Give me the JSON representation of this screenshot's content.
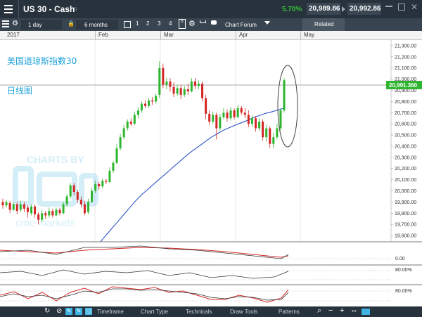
{
  "window": {
    "title": "US 30 - Cash",
    "change_pct": "5.70%",
    "sell_price": "20,989.86",
    "buy_price": "20,992.86"
  },
  "toolbar": {
    "interval": "1 day",
    "range": "6 months",
    "numbers": [
      "1",
      "2",
      "3",
      "4",
      "6"
    ],
    "chart_forum": "Chart Forum",
    "related": "Related"
  },
  "timeline": {
    "year": "2017",
    "months": [
      "Feb",
      "Mar",
      "Apr",
      "May"
    ]
  },
  "annotations": {
    "title_cn": "美国道琼斯指数30",
    "subtitle_cn": "日线图"
  },
  "watermark": {
    "line1": "CHARTS BY",
    "line2": "cmc markets"
  },
  "price_label": "20,991.360",
  "indicator_labels": [
    "0.00",
    "80.00%",
    "80.00%"
  ],
  "bottom_tabs": [
    "Timeframe",
    "Chart Type",
    "Technicals",
    "Draw Tools",
    "Patterns"
  ],
  "colors": {
    "up": "#2fb52f",
    "down": "#d42727",
    "ma": "#2a56c6",
    "panel": "#27323c",
    "accent": "#3fb3e3"
  },
  "chart_data": {
    "type": "candlestick",
    "y_ticks": [
      "21,300.00",
      "21,200.00",
      "21,100.00",
      "21,000.00",
      "20,900.00",
      "20,800.00",
      "20,700.00",
      "20,600.00",
      "20,500.00",
      "20,400.00",
      "20,300.00",
      "20,200.00",
      "20,100.00",
      "20,000.00",
      "19,900.00",
      "19,800.00",
      "19,700.00",
      "19,600.00"
    ],
    "ylim": [
      19550,
      21350
    ],
    "last_price": 20991.36,
    "candles": [
      {
        "o": 19900,
        "c": 19870,
        "h": 19930,
        "l": 19840
      },
      {
        "o": 19870,
        "c": 19900,
        "h": 19920,
        "l": 19850
      },
      {
        "o": 19890,
        "c": 19830,
        "h": 19910,
        "l": 19800
      },
      {
        "o": 19830,
        "c": 19880,
        "h": 19900,
        "l": 19820
      },
      {
        "o": 19880,
        "c": 19820,
        "h": 19900,
        "l": 19790
      },
      {
        "o": 19830,
        "c": 19880,
        "h": 19910,
        "l": 19810
      },
      {
        "o": 19880,
        "c": 19840,
        "h": 19900,
        "l": 19810
      },
      {
        "o": 19850,
        "c": 19810,
        "h": 19870,
        "l": 19760
      },
      {
        "o": 19800,
        "c": 19860,
        "h": 19880,
        "l": 19780
      },
      {
        "o": 19860,
        "c": 19790,
        "h": 19880,
        "l": 19760
      },
      {
        "o": 19790,
        "c": 19740,
        "h": 19810,
        "l": 19700
      },
      {
        "o": 19740,
        "c": 19800,
        "h": 19830,
        "l": 19720
      },
      {
        "o": 19800,
        "c": 19780,
        "h": 19820,
        "l": 19750
      },
      {
        "o": 19780,
        "c": 19820,
        "h": 19850,
        "l": 19760
      },
      {
        "o": 19820,
        "c": 19780,
        "h": 19840,
        "l": 19760
      },
      {
        "o": 19780,
        "c": 19830,
        "h": 19850,
        "l": 19770
      },
      {
        "o": 19830,
        "c": 19800,
        "h": 19850,
        "l": 19780
      },
      {
        "o": 19800,
        "c": 19880,
        "h": 19900,
        "l": 19790
      },
      {
        "o": 19880,
        "c": 19950,
        "h": 19970,
        "l": 19860
      },
      {
        "o": 19950,
        "c": 20050,
        "h": 20070,
        "l": 19930
      },
      {
        "o": 20050,
        "c": 19990,
        "h": 20070,
        "l": 19960
      },
      {
        "o": 19990,
        "c": 19920,
        "h": 20010,
        "l": 19890
      },
      {
        "o": 19920,
        "c": 19880,
        "h": 19950,
        "l": 19850
      },
      {
        "o": 19880,
        "c": 19800,
        "h": 19910,
        "l": 19780
      },
      {
        "o": 19810,
        "c": 19900,
        "h": 19930,
        "l": 19790
      },
      {
        "o": 19900,
        "c": 20000,
        "h": 20030,
        "l": 19890
      },
      {
        "o": 20000,
        "c": 20060,
        "h": 20090,
        "l": 19980
      },
      {
        "o": 20060,
        "c": 20040,
        "h": 20080,
        "l": 20010
      },
      {
        "o": 20040,
        "c": 20090,
        "h": 20110,
        "l": 20020
      },
      {
        "o": 20090,
        "c": 20080,
        "h": 20110,
        "l": 20060
      },
      {
        "o": 20080,
        "c": 20180,
        "h": 20210,
        "l": 20070
      },
      {
        "o": 20180,
        "c": 20250,
        "h": 20270,
        "l": 20160
      },
      {
        "o": 20250,
        "c": 20380,
        "h": 20420,
        "l": 20240
      },
      {
        "o": 20380,
        "c": 20480,
        "h": 20510,
        "l": 20360
      },
      {
        "o": 20480,
        "c": 20560,
        "h": 20590,
        "l": 20460
      },
      {
        "o": 20560,
        "c": 20620,
        "h": 20640,
        "l": 20540
      },
      {
        "o": 20620,
        "c": 20600,
        "h": 20650,
        "l": 20580
      },
      {
        "o": 20600,
        "c": 20680,
        "h": 20710,
        "l": 20590
      },
      {
        "o": 20680,
        "c": 20720,
        "h": 20750,
        "l": 20650
      },
      {
        "o": 20720,
        "c": 20780,
        "h": 20800,
        "l": 20700
      },
      {
        "o": 20780,
        "c": 20760,
        "h": 20810,
        "l": 20740
      },
      {
        "o": 20760,
        "c": 20810,
        "h": 20830,
        "l": 20740
      },
      {
        "o": 20810,
        "c": 20800,
        "h": 20840,
        "l": 20770
      },
      {
        "o": 20800,
        "c": 20850,
        "h": 20870,
        "l": 20780
      },
      {
        "o": 20860,
        "c": 21100,
        "h": 21160,
        "l": 20830
      },
      {
        "o": 21100,
        "c": 20950,
        "h": 21140,
        "l": 20920
      },
      {
        "o": 20950,
        "c": 20980,
        "h": 21010,
        "l": 20910
      },
      {
        "o": 20980,
        "c": 20930,
        "h": 21010,
        "l": 20890
      },
      {
        "o": 20930,
        "c": 20870,
        "h": 20970,
        "l": 20840
      },
      {
        "o": 20870,
        "c": 20920,
        "h": 20950,
        "l": 20850
      },
      {
        "o": 20920,
        "c": 20860,
        "h": 20950,
        "l": 20820
      },
      {
        "o": 20860,
        "c": 20910,
        "h": 20940,
        "l": 20840
      },
      {
        "o": 20910,
        "c": 20890,
        "h": 20960,
        "l": 20860
      },
      {
        "o": 20890,
        "c": 20980,
        "h": 21010,
        "l": 20880
      },
      {
        "o": 20980,
        "c": 20940,
        "h": 21010,
        "l": 20910
      },
      {
        "o": 20940,
        "c": 20960,
        "h": 20990,
        "l": 20910
      },
      {
        "o": 20960,
        "c": 20830,
        "h": 20980,
        "l": 20800
      },
      {
        "o": 20830,
        "c": 20690,
        "h": 20860,
        "l": 20640
      },
      {
        "o": 20690,
        "c": 20620,
        "h": 20720,
        "l": 20590
      },
      {
        "o": 20620,
        "c": 20680,
        "h": 20710,
        "l": 20600
      },
      {
        "o": 20680,
        "c": 20560,
        "h": 20700,
        "l": 20460
      },
      {
        "o": 20560,
        "c": 20660,
        "h": 20690,
        "l": 20540
      },
      {
        "o": 20660,
        "c": 20700,
        "h": 20740,
        "l": 20640
      },
      {
        "o": 20700,
        "c": 20650,
        "h": 20730,
        "l": 20620
      },
      {
        "o": 20650,
        "c": 20720,
        "h": 20750,
        "l": 20630
      },
      {
        "o": 20720,
        "c": 20660,
        "h": 20740,
        "l": 20640
      },
      {
        "o": 20660,
        "c": 20740,
        "h": 20770,
        "l": 20650
      },
      {
        "o": 20740,
        "c": 20700,
        "h": 20760,
        "l": 20680
      },
      {
        "o": 20700,
        "c": 20680,
        "h": 20740,
        "l": 20650
      },
      {
        "o": 20680,
        "c": 20600,
        "h": 20720,
        "l": 20570
      },
      {
        "o": 20600,
        "c": 20650,
        "h": 20680,
        "l": 20570
      },
      {
        "o": 20650,
        "c": 20560,
        "h": 20670,
        "l": 20530
      },
      {
        "o": 20560,
        "c": 20620,
        "h": 20650,
        "l": 20540
      },
      {
        "o": 20620,
        "c": 20480,
        "h": 20640,
        "l": 20450
      },
      {
        "o": 20480,
        "c": 20560,
        "h": 20590,
        "l": 20440
      },
      {
        "o": 20560,
        "c": 20420,
        "h": 20580,
        "l": 20380
      },
      {
        "o": 20420,
        "c": 20480,
        "h": 20520,
        "l": 20380
      },
      {
        "o": 20480,
        "c": 20560,
        "h": 20600,
        "l": 20460
      },
      {
        "o": 20560,
        "c": 20720,
        "h": 20740,
        "l": 20540
      },
      {
        "o": 20720,
        "c": 20990,
        "h": 21010,
        "l": 20700
      }
    ],
    "ma": [
      19390,
      19420,
      19460,
      19500,
      19540,
      19580,
      19620,
      19660,
      19700,
      19740,
      19780,
      19820,
      19860,
      19900,
      19935,
      19970,
      20000,
      20030,
      20060,
      20090,
      20120,
      20150,
      20180,
      20210,
      20240,
      20270,
      20300,
      20330,
      20355,
      20380,
      20405,
      20430,
      20455,
      20480,
      20500,
      20520,
      20540,
      20555,
      20570,
      20585,
      20600,
      20612,
      20625,
      20640,
      20655,
      20668,
      20680,
      20692,
      20700,
      20710,
      20720,
      20730,
      20740
    ]
  }
}
